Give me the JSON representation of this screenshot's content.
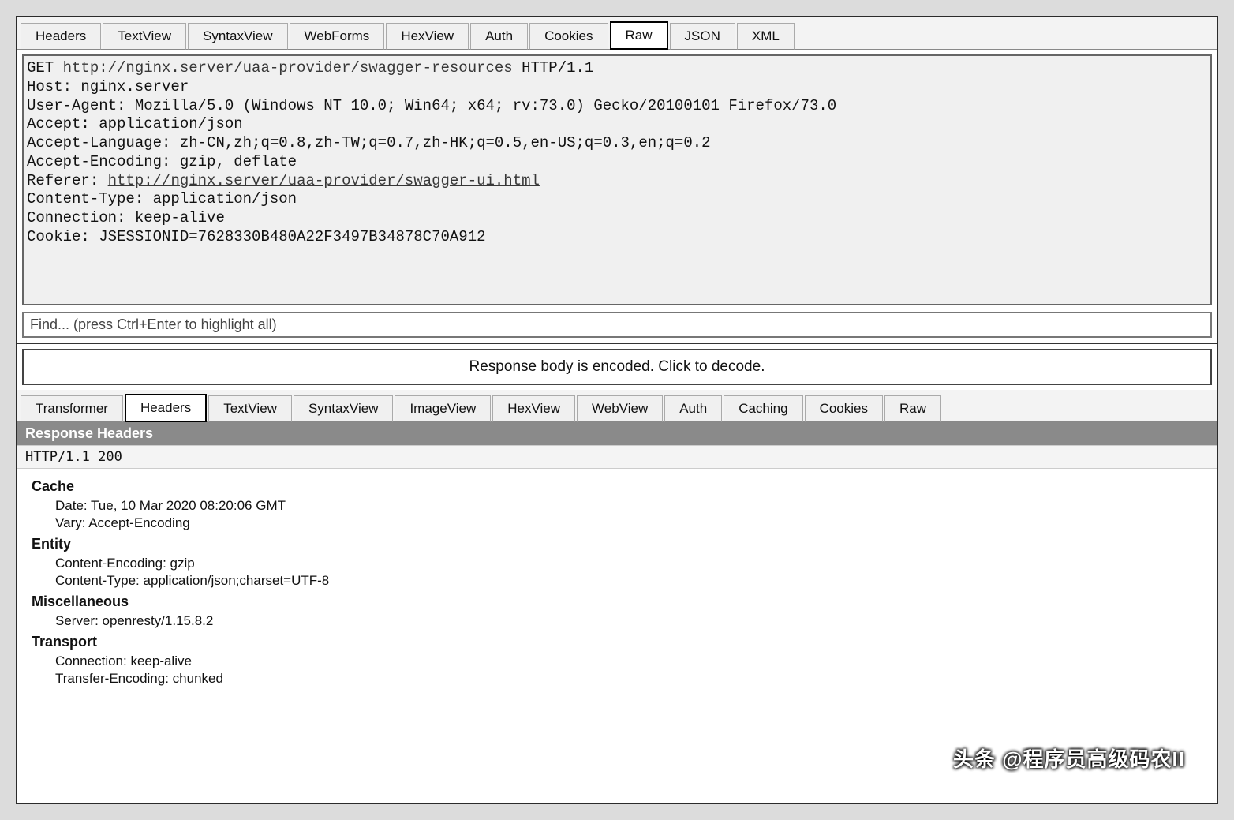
{
  "request_tabs": [
    "Headers",
    "TextView",
    "SyntaxView",
    "WebForms",
    "HexView",
    "Auth",
    "Cookies",
    "Raw",
    "JSON",
    "XML"
  ],
  "request_active_tab": "Raw",
  "raw": {
    "method": "GET ",
    "url": "http://nginx.server/uaa-provider/swagger-resources",
    "protocol": " HTTP/1.1",
    "lines": [
      "Host: nginx.server",
      "User-Agent: Mozilla/5.0 (Windows NT 10.0; Win64; x64; rv:73.0) Gecko/20100101 Firefox/73.0",
      "Accept: application/json",
      "Accept-Language: zh-CN,zh;q=0.8,zh-TW;q=0.7,zh-HK;q=0.5,en-US;q=0.3,en;q=0.2",
      "Accept-Encoding: gzip, deflate"
    ],
    "referer_label": "Referer: ",
    "referer_url": "http://nginx.server/uaa-provider/swagger-ui.html",
    "lines2": [
      "Content-Type: application/json",
      "Connection: keep-alive",
      "Cookie: JSESSIONID=7628330B480A22F3497B34878C70A912"
    ]
  },
  "find_placeholder": "Find... (press Ctrl+Enter to highlight all)",
  "decode_banner": "Response body is encoded. Click to decode.",
  "response_tabs": [
    "Transformer",
    "Headers",
    "TextView",
    "SyntaxView",
    "ImageView",
    "HexView",
    "WebView",
    "Auth",
    "Caching",
    "Cookies",
    "Raw"
  ],
  "response_active_tab": "Headers",
  "response_section_title": "Response Headers",
  "response_status": "HTTP/1.1 200",
  "response_groups": [
    {
      "title": "Cache",
      "items": [
        "Date: Tue, 10 Mar 2020 08:20:06 GMT",
        "Vary: Accept-Encoding"
      ]
    },
    {
      "title": "Entity",
      "items": [
        "Content-Encoding: gzip",
        "Content-Type: application/json;charset=UTF-8"
      ]
    },
    {
      "title": "Miscellaneous",
      "items": [
        "Server: openresty/1.15.8.2"
      ]
    },
    {
      "title": "Transport",
      "items": [
        "Connection: keep-alive",
        "Transfer-Encoding: chunked"
      ]
    }
  ],
  "watermark": "头条 @程序员高级码农II"
}
